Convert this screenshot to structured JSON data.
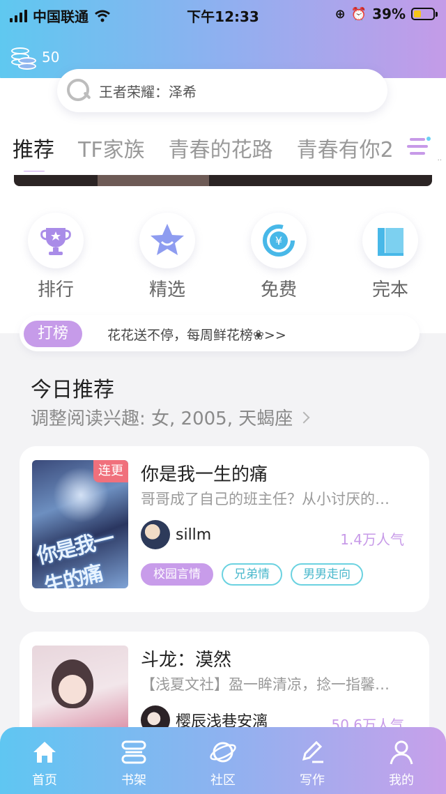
{
  "status_bar": {
    "carrier": "中国联通",
    "time": "下午12:33",
    "battery": "39%"
  },
  "wallet": {
    "coins": "50"
  },
  "search": {
    "text": "王者荣耀：泽希"
  },
  "tabs": [
    {
      "label": "推荐",
      "active": true
    },
    {
      "label": "TF家族",
      "active": false
    },
    {
      "label": "青春的花路",
      "active": false
    },
    {
      "label": "青春有你2",
      "active": false
    }
  ],
  "quick_entries": [
    {
      "label": "排行",
      "icon": "trophy-icon"
    },
    {
      "label": "精选",
      "icon": "star-icon"
    },
    {
      "label": "免费",
      "icon": "yuan-icon"
    },
    {
      "label": "完本",
      "icon": "book-icon"
    }
  ],
  "ticker": {
    "tag": "打榜",
    "text": "花花送不停，每周鲜花榜❀>>"
  },
  "section": {
    "title": "今日推荐",
    "subtitle": "调整阅读兴趣: 女, 2005, 天蝎座"
  },
  "books": [
    {
      "title": "你是我一生的痛",
      "desc": "哥哥成了自己的班主任？从小讨厌的…",
      "author": "sillm",
      "popularity": "1.4万人气",
      "badge": "连更",
      "cover_text": "你是我一生的痛",
      "tags": [
        "校园言情",
        "兄弟情",
        "男男走向"
      ]
    },
    {
      "title": "斗龙：漠然",
      "desc": "【浅夏文社】盈一眸清凉，捻一指馨…",
      "author": "樱辰浅巷安漓",
      "popularity": "50.6万人气"
    }
  ],
  "nav": [
    {
      "label": "首页",
      "icon": "home-icon",
      "active": true
    },
    {
      "label": "书架",
      "icon": "bookshelf-icon",
      "active": false
    },
    {
      "label": "社区",
      "icon": "planet-icon",
      "active": false
    },
    {
      "label": "写作",
      "icon": "pen-icon",
      "active": false
    },
    {
      "label": "我的",
      "icon": "user-icon",
      "active": false
    }
  ],
  "colors": {
    "gradient_start": "#5fc8f0",
    "gradient_end": "#c49be8",
    "accent_purple": "#c69be9",
    "accent_cyan": "#6bd2e0",
    "badge_red": "#f0707c"
  }
}
